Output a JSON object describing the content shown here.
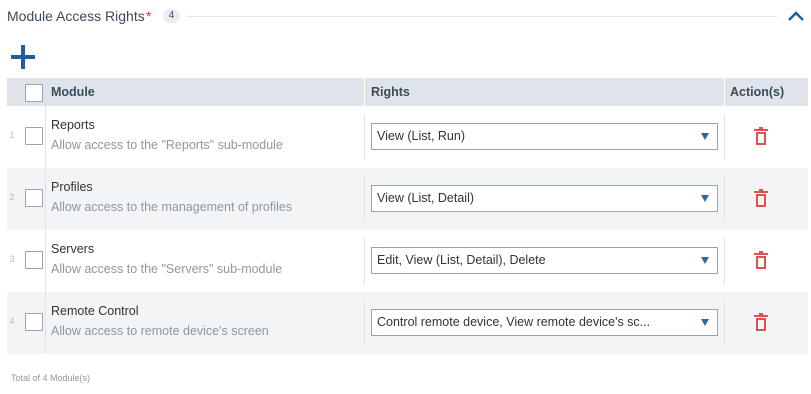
{
  "section": {
    "title": "Module Access Rights",
    "required_mark": "*",
    "count": "4"
  },
  "table": {
    "headers": {
      "module": "Module",
      "rights": "Rights",
      "actions": "Action(s)"
    },
    "rows": [
      {
        "num": "1",
        "name": "Reports",
        "description": "Allow access to the \"Reports\" sub-module",
        "rights": "View (List, Run)"
      },
      {
        "num": "2",
        "name": "Profiles",
        "description": "Allow access to the management of profiles",
        "rights": "View (List, Detail)"
      },
      {
        "num": "3",
        "name": "Servers",
        "description": "Allow access to the \"Servers\" sub-module",
        "rights": "Edit, View (List, Detail), Delete"
      },
      {
        "num": "4",
        "name": "Remote Control",
        "description": "Allow access to remote device's screen",
        "rights": "Control remote device, View remote device's sc..."
      }
    ]
  },
  "footer": {
    "total": "Total of 4 Module(s)"
  },
  "icons": {
    "add": "plus-icon",
    "collapse": "chevron-up-icon",
    "delete": "trash-icon"
  },
  "colors": {
    "accent": "#1f5f9e",
    "delete": "#d9534f",
    "header_bg": "#dfe4ea",
    "row_alt_bg": "#f2f4f6"
  }
}
